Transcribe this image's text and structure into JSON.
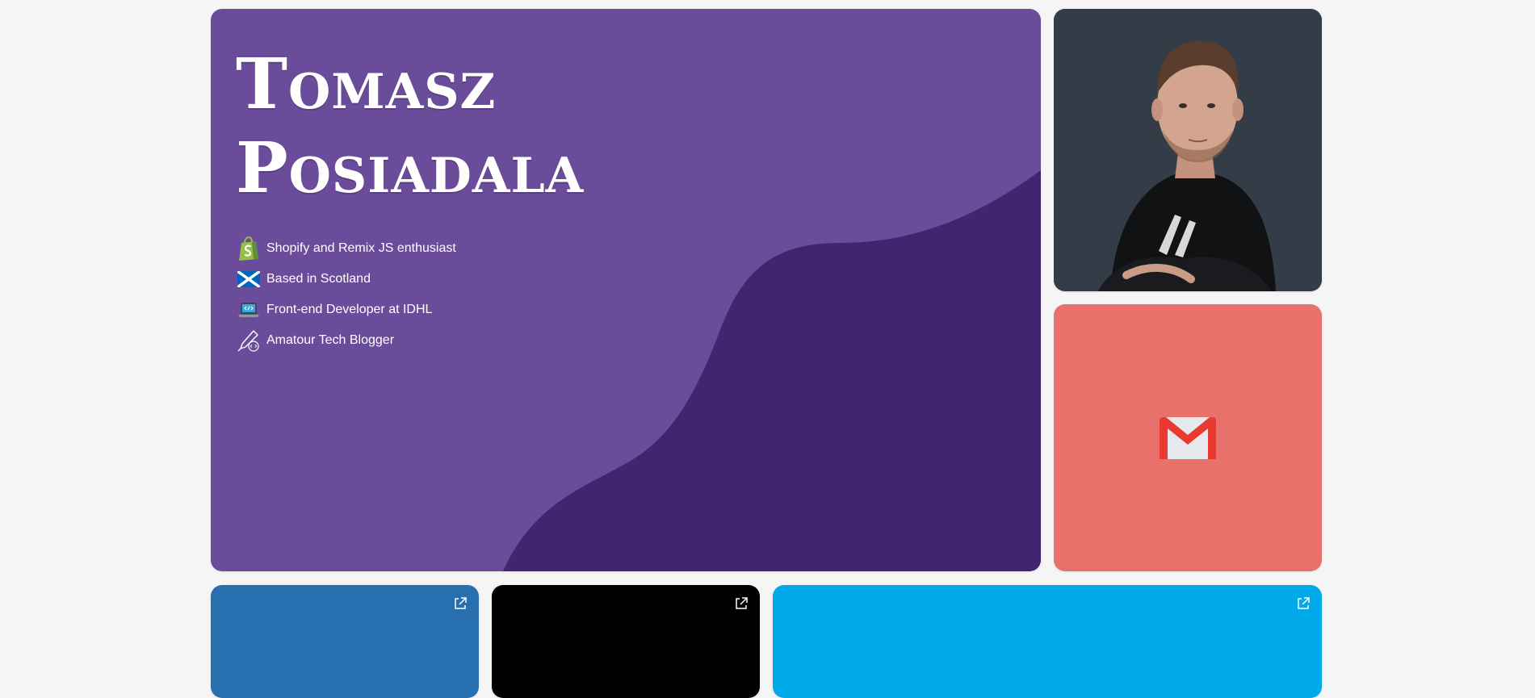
{
  "profile": {
    "name_line1": "Tomasz",
    "name_line2": "Posiadala",
    "facts": [
      {
        "icon": "shopify-bag-icon",
        "label": "Shopify and Remix JS enthusiast"
      },
      {
        "icon": "scotland-flag-icon",
        "label": "Based in Scotland"
      },
      {
        "icon": "laptop-code-icon",
        "label": "Front-end Developer at IDHL"
      },
      {
        "icon": "pen-code-icon",
        "label": "Amatour Tech Blogger"
      }
    ]
  },
  "contact": {
    "icon": "gmail-icon"
  },
  "tiles": [
    {
      "icon": "external-link-icon",
      "color": "#276faf"
    },
    {
      "icon": "external-link-icon",
      "color": "#000000"
    },
    {
      "icon": "external-link-icon",
      "color": "#00a9e8"
    }
  ],
  "colors": {
    "hero": "#6a4c9a",
    "hero_wave": "#41266f",
    "photo_bg": "#333c47",
    "mail_bg": "#e8726b"
  }
}
